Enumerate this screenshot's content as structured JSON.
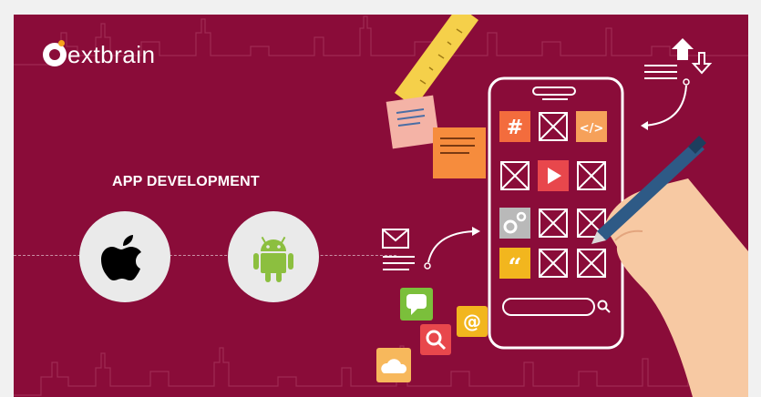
{
  "brand": {
    "logo_text": "extbrain"
  },
  "banner": {
    "heading": "APP DEVELOPMENT",
    "background_color": "#8a0c39"
  },
  "platforms": [
    {
      "name": "apple-icon"
    },
    {
      "name": "android-icon"
    }
  ],
  "phone": {
    "app_tiles": [
      {
        "icon": "hash-icon",
        "color": "#f36c3d"
      },
      {
        "icon": "empty-box-icon"
      },
      {
        "icon": "code-icon",
        "color": "#f6a15a"
      },
      {
        "icon": "empty-box-icon"
      },
      {
        "icon": "play-icon",
        "color": "#e8474c"
      },
      {
        "icon": "empty-box-icon"
      },
      {
        "icon": "gears-icon",
        "color": "#b9b9b9"
      },
      {
        "icon": "empty-box-icon"
      },
      {
        "icon": "empty-box-icon"
      },
      {
        "icon": "quote-icon",
        "color": "#f2b61e"
      },
      {
        "icon": "empty-box-icon"
      },
      {
        "icon": "empty-box-icon"
      }
    ]
  },
  "floating_icons": [
    "chat-icon",
    "at-icon",
    "search-icon",
    "cloud-icon",
    "mail-icon",
    "upload-download-icon"
  ]
}
